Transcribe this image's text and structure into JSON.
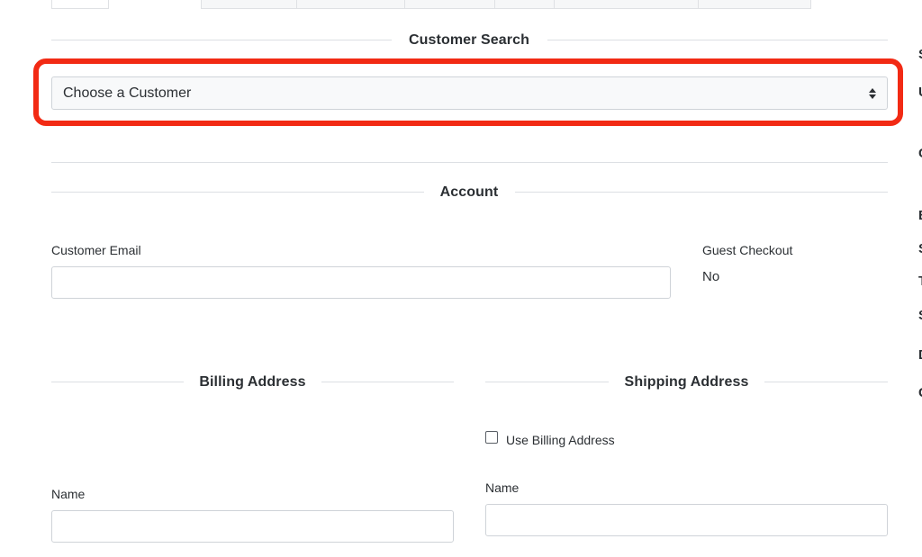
{
  "sections": {
    "customer_search": "Customer Search",
    "account": "Account",
    "billing_address": "Billing Address",
    "shipping_address": "Shipping Address"
  },
  "customer_select": {
    "value": "Choose a Customer",
    "icon": "sort-icon"
  },
  "account": {
    "email_label": "Customer Email",
    "email_value": "",
    "guest_checkout_label": "Guest Checkout",
    "guest_checkout_value": "No"
  },
  "billing": {
    "name_label": "Name",
    "name_value": ""
  },
  "shipping": {
    "use_billing_label": "Use Billing Address",
    "use_billing_checked": false,
    "name_label": "Name",
    "name_value": ""
  },
  "highlight_color": "#f22a14"
}
